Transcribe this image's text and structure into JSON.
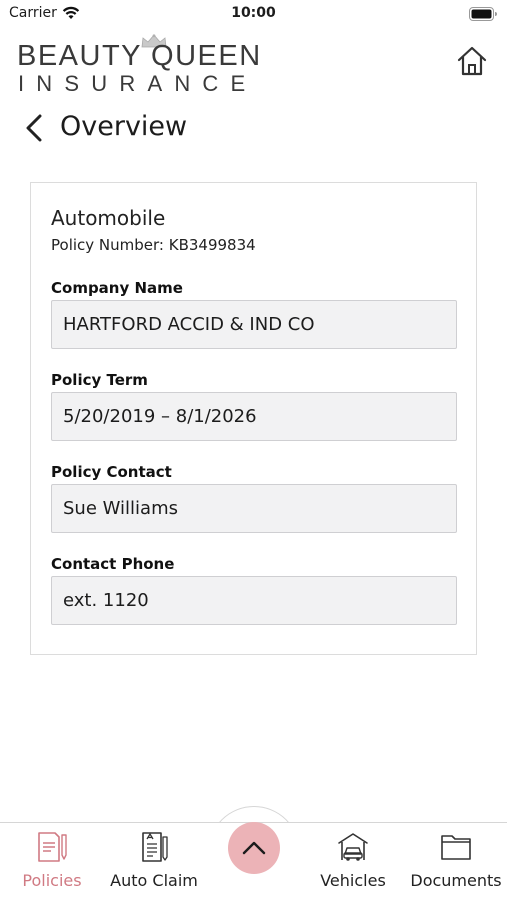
{
  "status_bar": {
    "carrier": "Carrier",
    "time": "10:00"
  },
  "header": {
    "logo_line1": "BEAUTY QUEEN",
    "logo_line2": "INSURANCE",
    "home_icon": "home-icon"
  },
  "page": {
    "title": "Overview",
    "back_icon": "chevron-left-icon"
  },
  "policy": {
    "type": "Automobile",
    "number": "Policy Number: KB3499834",
    "fields": [
      {
        "label": "Company Name",
        "value": "HARTFORD ACCID & IND CO"
      },
      {
        "label": "Policy Term",
        "value": "5/20/2019 – 8/1/2026"
      },
      {
        "label": "Policy Contact",
        "value": "Sue Williams"
      },
      {
        "label": "Contact Phone",
        "value": "ext. 1120"
      }
    ]
  },
  "tab_bar": {
    "tabs": [
      {
        "label": "Policies",
        "icon": "policy-document-icon",
        "active": true
      },
      {
        "label": "Auto Claim",
        "icon": "claim-form-icon",
        "active": false
      },
      {
        "label": "Vehicles",
        "icon": "car-garage-icon",
        "active": false
      },
      {
        "label": "Documents",
        "icon": "folder-icon",
        "active": false
      }
    ],
    "center_icon": "chevron-up-icon"
  },
  "colors": {
    "accent": "#D07A83",
    "center_button": "#ECB3B7",
    "field_background": "#F2F2F3"
  }
}
